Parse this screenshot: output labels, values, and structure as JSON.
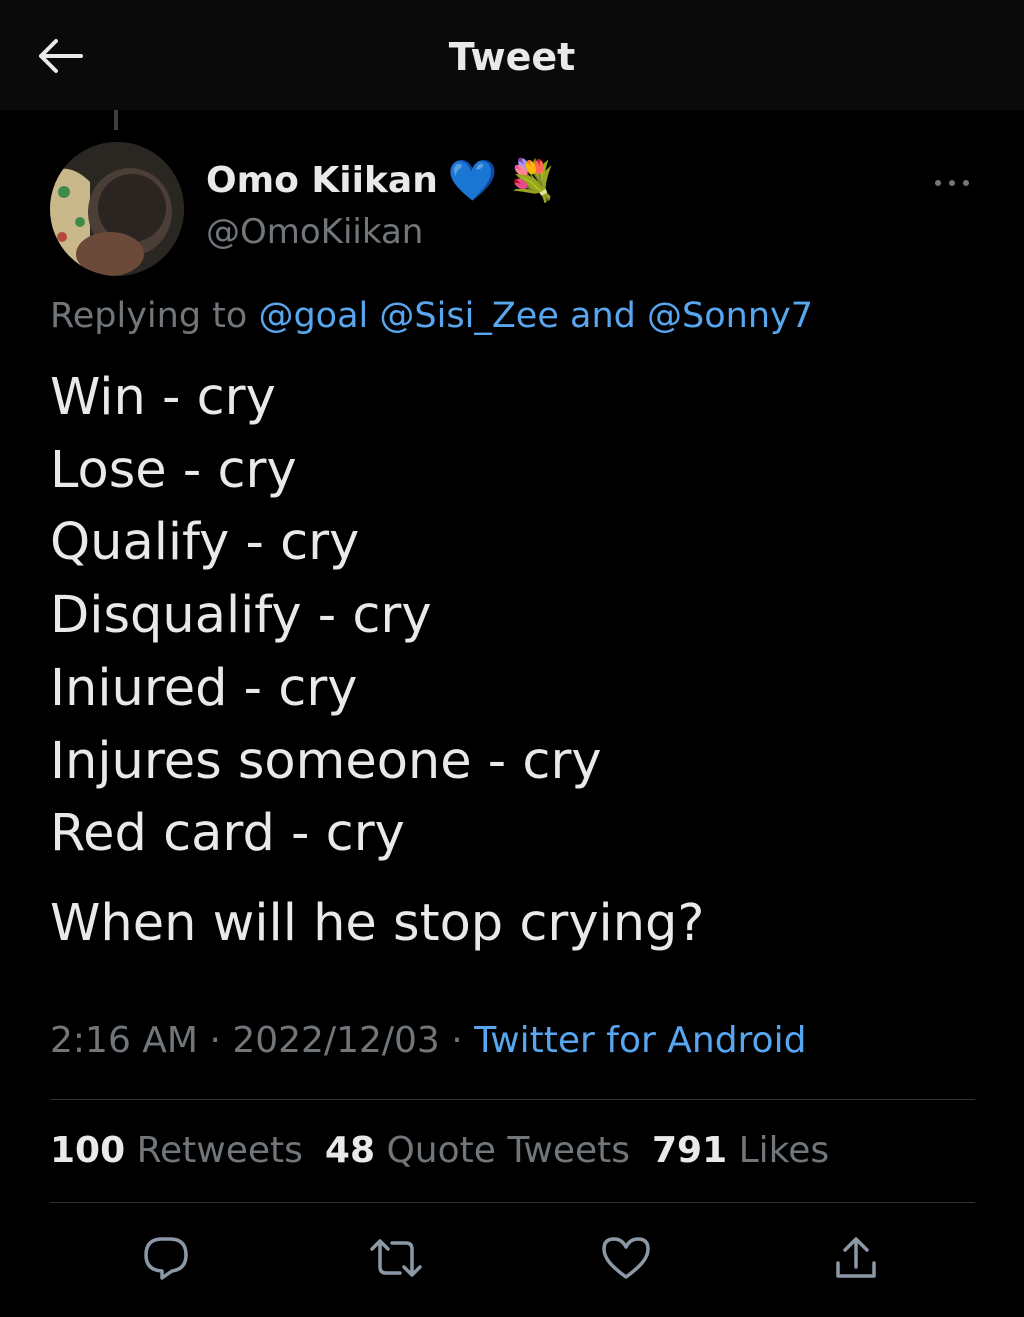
{
  "header": {
    "title": "Tweet",
    "back_icon": "arrow-left-icon"
  },
  "author": {
    "display_name": "Omo Kiikan",
    "emoji_heart": "💙",
    "emoji_flowers": "💐",
    "handle": "@OmoKiikan"
  },
  "reply": {
    "prefix": "Replying to",
    "mention_1": "@goal",
    "mention_2": "@Sisi_Zee",
    "conjunction": "and",
    "mention_3": "@Sonny7"
  },
  "tweet": {
    "lines": [
      "Win - cry",
      "Lose - cry",
      "Qualify - cry",
      "Disqualify - cry",
      "Iniured - cry",
      "Injures someone - cry",
      "Red card - cry"
    ],
    "final_line": "When will he stop crying?"
  },
  "meta": {
    "time": "2:16 AM",
    "sep1": "·",
    "date": "2022/12/03",
    "sep2": "·",
    "source": "Twitter for Android"
  },
  "stats": {
    "retweets_count": "100",
    "retweets_label": "Retweets",
    "quotes_count": "48",
    "quotes_label": "Quote Tweets",
    "likes_count": "791",
    "likes_label": "Likes"
  },
  "actions": [
    "reply-icon",
    "retweet-icon",
    "like-icon",
    "share-icon"
  ],
  "colors": {
    "background": "#000000",
    "accent": "#58a6ef",
    "muted": "#71767b",
    "text": "#e7e9ea"
  }
}
